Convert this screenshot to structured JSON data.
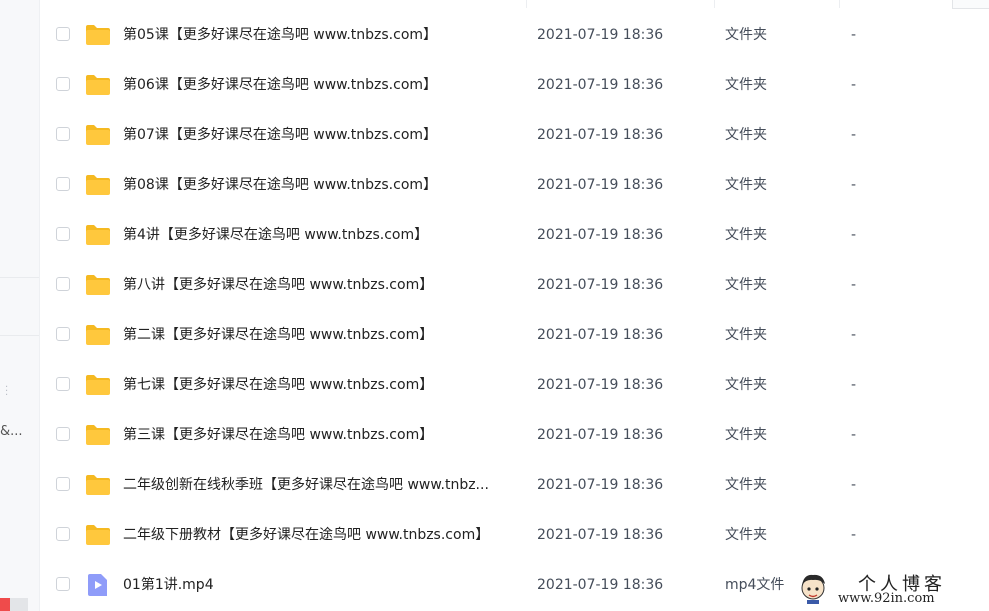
{
  "sidebar": {
    "truncated_text": "&..."
  },
  "files": [
    {
      "name": "第05课【更多好课尽在途鸟吧 www.tnbzs.com】",
      "time": "2021-07-19 18:36",
      "type": "文件夹",
      "size": "-",
      "kind": "folder"
    },
    {
      "name": "第06课【更多好课尽在途鸟吧 www.tnbzs.com】",
      "time": "2021-07-19 18:36",
      "type": "文件夹",
      "size": "-",
      "kind": "folder"
    },
    {
      "name": "第07课【更多好课尽在途鸟吧 www.tnbzs.com】",
      "time": "2021-07-19 18:36",
      "type": "文件夹",
      "size": "-",
      "kind": "folder"
    },
    {
      "name": "第08课【更多好课尽在途鸟吧 www.tnbzs.com】",
      "time": "2021-07-19 18:36",
      "type": "文件夹",
      "size": "-",
      "kind": "folder"
    },
    {
      "name": "第4讲【更多好课尽在途鸟吧 www.tnbzs.com】",
      "time": "2021-07-19 18:36",
      "type": "文件夹",
      "size": "-",
      "kind": "folder"
    },
    {
      "name": "第八讲【更多好课尽在途鸟吧 www.tnbzs.com】",
      "time": "2021-07-19 18:36",
      "type": "文件夹",
      "size": "-",
      "kind": "folder"
    },
    {
      "name": "第二课【更多好课尽在途鸟吧 www.tnbzs.com】",
      "time": "2021-07-19 18:36",
      "type": "文件夹",
      "size": "-",
      "kind": "folder"
    },
    {
      "name": "第七课【更多好课尽在途鸟吧 www.tnbzs.com】",
      "time": "2021-07-19 18:36",
      "type": "文件夹",
      "size": "-",
      "kind": "folder"
    },
    {
      "name": "第三课【更多好课尽在途鸟吧 www.tnbzs.com】",
      "time": "2021-07-19 18:36",
      "type": "文件夹",
      "size": "-",
      "kind": "folder"
    },
    {
      "name": "二年级创新在线秋季班【更多好课尽在途鸟吧 www.tnbz...",
      "time": "2021-07-19 18:36",
      "type": "文件夹",
      "size": "-",
      "kind": "folder"
    },
    {
      "name": "二年级下册教材【更多好课尽在途鸟吧 www.tnbzs.com】",
      "time": "2021-07-19 18:36",
      "type": "文件夹",
      "size": "-",
      "kind": "folder"
    },
    {
      "name": "01第1讲.mp4",
      "time": "2021-07-19 18:36",
      "type": "mp4文件",
      "size": "",
      "kind": "video"
    }
  ],
  "watermark": {
    "title": "个人博客",
    "url": "www.92in.com"
  },
  "colors": {
    "folder": "#ffc83d",
    "folder_tab": "#f5b921",
    "video": "#8f9cf9",
    "checkbox_border": "#cfd3d9",
    "text": "#222222",
    "meta_text": "#454d5a",
    "accent_red": "#ef4b4b"
  },
  "icons": {
    "folder": "folder-icon",
    "video": "video-file-icon",
    "checkbox": "checkbox-icon"
  }
}
